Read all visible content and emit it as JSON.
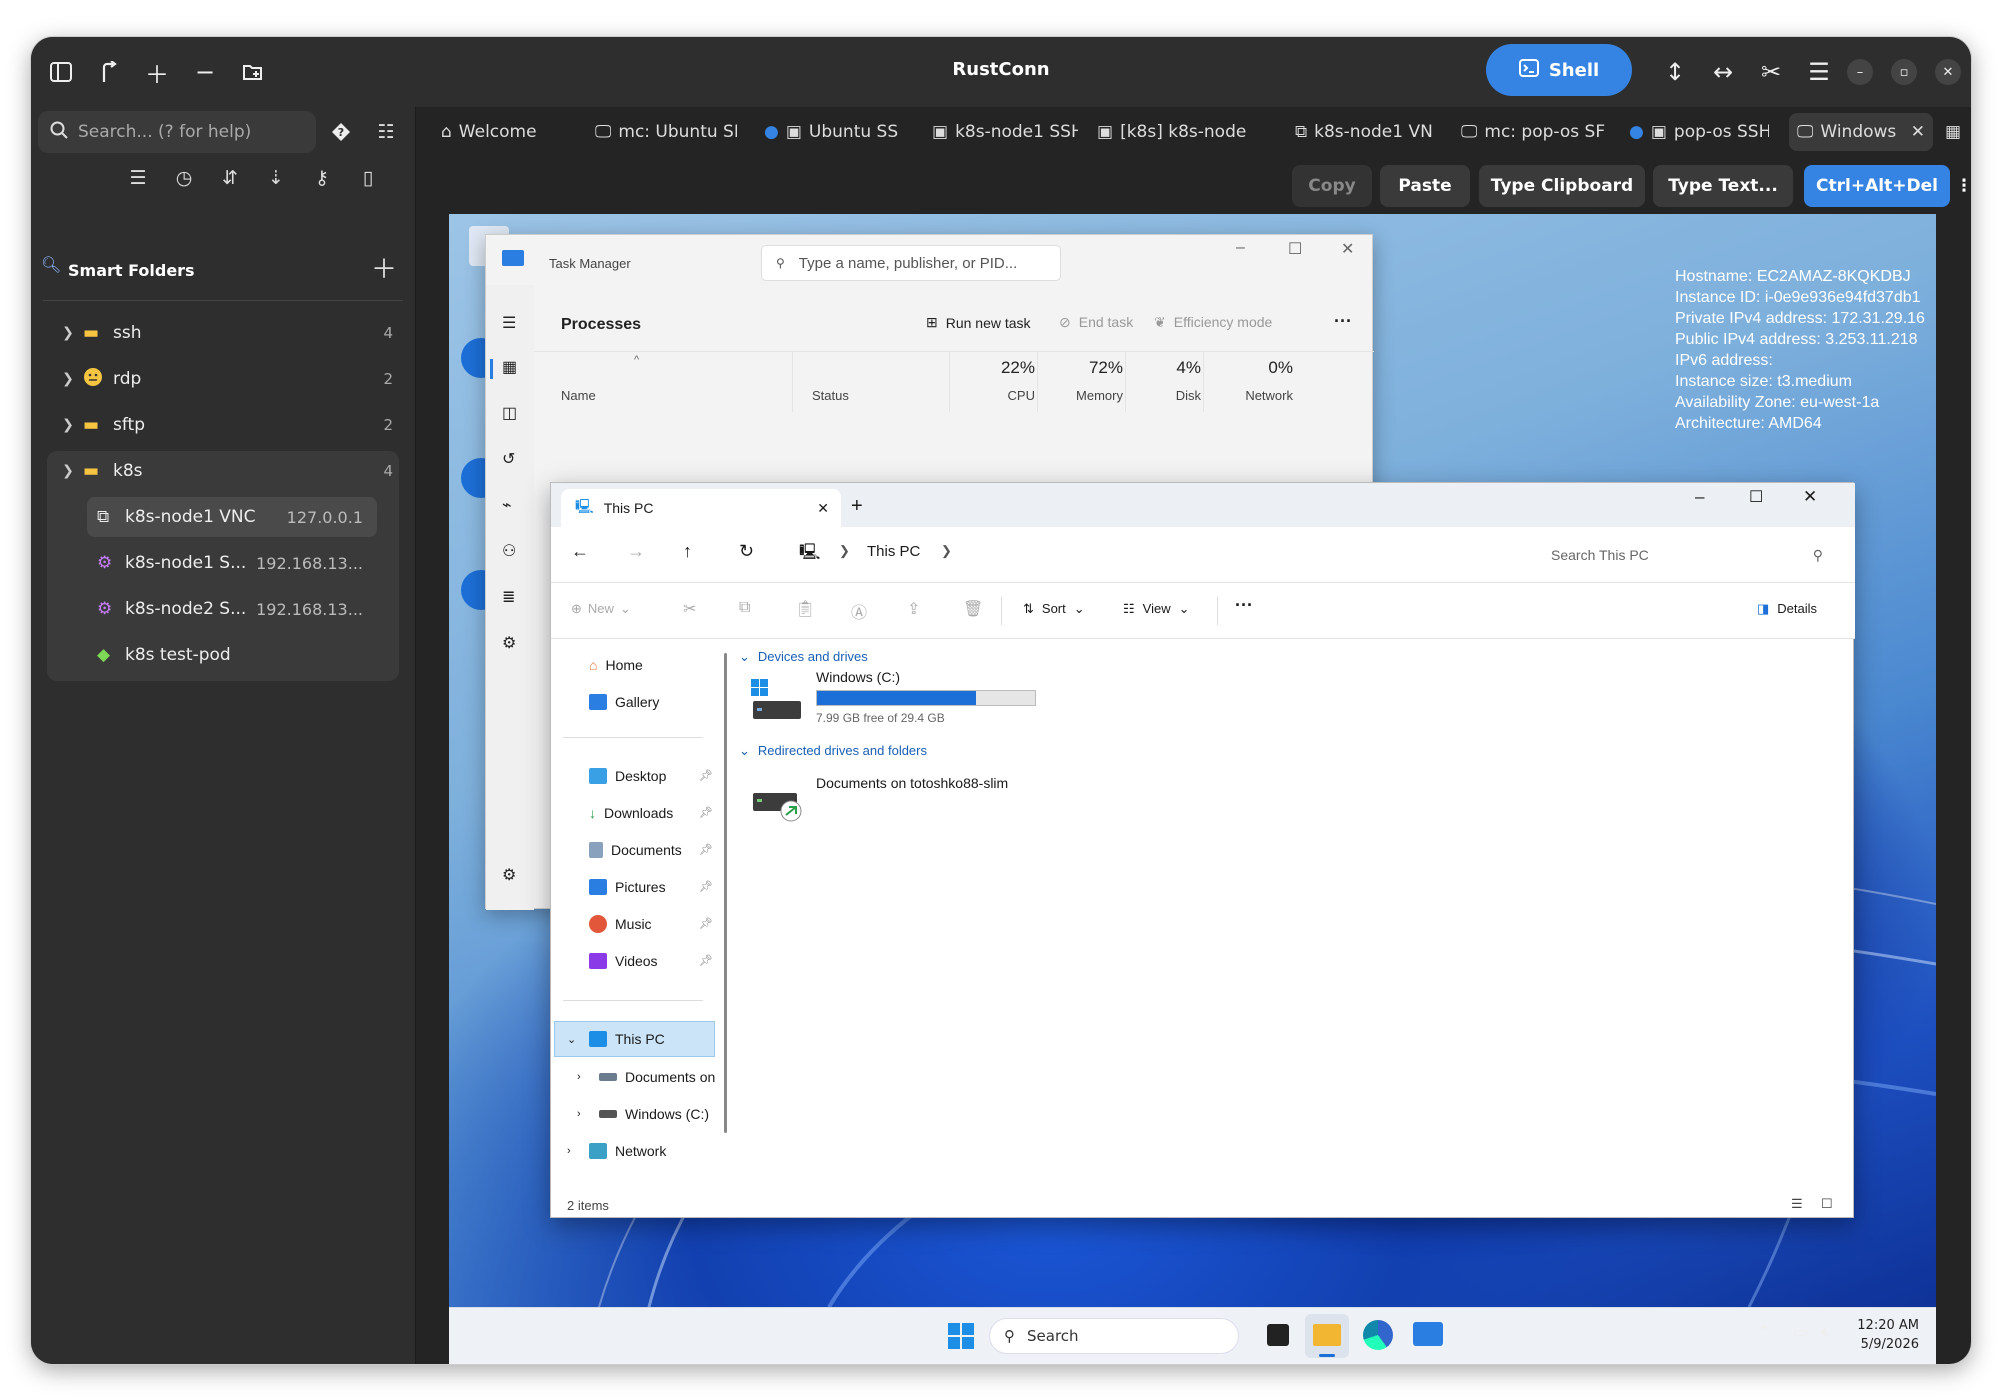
{
  "app": {
    "title": "RustConn",
    "shell_label": "Shell"
  },
  "sidebar": {
    "search_placeholder": "Search... (? for help)",
    "smart_folders_label": "Smart Folders",
    "groups": [
      {
        "name": "ssh",
        "count": "4"
      },
      {
        "name": "rdp",
        "count": "2"
      },
      {
        "name": "sftp",
        "count": "2"
      },
      {
        "name": "k8s",
        "count": "4"
      }
    ],
    "k8s_items": [
      {
        "name": "k8s-node1 VNC",
        "host": "127.0.0.1"
      },
      {
        "name": "k8s-node1 S...",
        "host": "192.168.13..."
      },
      {
        "name": "k8s-node2 S...",
        "host": "192.168.13..."
      },
      {
        "name": "k8s test-pod",
        "host": ""
      }
    ]
  },
  "tabs": [
    {
      "label": "Welcome"
    },
    {
      "label": "mc: Ubuntu SF"
    },
    {
      "label": "Ubuntu SS"
    },
    {
      "label": "k8s-node1 SSH"
    },
    {
      "label": "[k8s] k8s-node"
    },
    {
      "label": "k8s-node1 VN"
    },
    {
      "label": "mc: pop-os SF"
    },
    {
      "label": "pop-os SSH"
    },
    {
      "label": "Windows"
    }
  ],
  "toolbar": {
    "copy": "Copy",
    "paste": "Paste",
    "type_clipboard": "Type Clipboard",
    "type_text": "Type Text...",
    "ctrl_alt_del": "Ctrl+Alt+Del"
  },
  "desktop": {
    "sysinfo": [
      "Hostname: EC2AMAZ-8KQKDBJ",
      "Instance ID: i-0e9e936e94fd37db1",
      "Private IPv4 address: 172.31.29.16",
      "Public IPv4 address: 3.253.11.218",
      "IPv6 address:",
      "Instance size: t3.medium",
      "Availability Zone: eu-west-1a",
      "Architecture: AMD64"
    ]
  },
  "task_manager": {
    "title": "Task Manager",
    "search_placeholder": "Type a name, publisher, or PID...",
    "heading": "Processes",
    "run_new_task": "Run new task",
    "end_task": "End task",
    "efficiency_mode": "Efficiency mode",
    "columns": {
      "name": "Name",
      "status": "Status",
      "cpu_pct": "22%",
      "cpu": "CPU",
      "mem_pct": "72%",
      "mem": "Memory",
      "disk_pct": "4%",
      "disk": "Disk",
      "net_pct": "0%",
      "net": "Network"
    }
  },
  "explorer": {
    "tab_title": "This PC",
    "breadcrumb": "This PC",
    "search_placeholder": "Search This PC",
    "cmd": {
      "new": "New",
      "sort": "Sort",
      "view": "View",
      "details": "Details"
    },
    "nav": {
      "home": "Home",
      "gallery": "Gallery",
      "desktop": "Desktop",
      "downloads": "Downloads",
      "documents": "Documents",
      "pictures": "Pictures",
      "music": "Music",
      "videos": "Videos",
      "this_pc": "This PC",
      "documents_on": "Documents on",
      "windows_c": "Windows (C:)",
      "network": "Network"
    },
    "sections": {
      "devices": "Devices and drives",
      "redirected": "Redirected drives and folders"
    },
    "drive": {
      "name": "Windows (C:)",
      "free": "7.99 GB free of 29.4 GB",
      "used_fraction": 0.73
    },
    "redirected_item": "Documents on totoshko88-slim",
    "status": "2 items"
  },
  "taskbar": {
    "search": "Search",
    "time": "12:20 AM",
    "date": "5/9/2026"
  }
}
